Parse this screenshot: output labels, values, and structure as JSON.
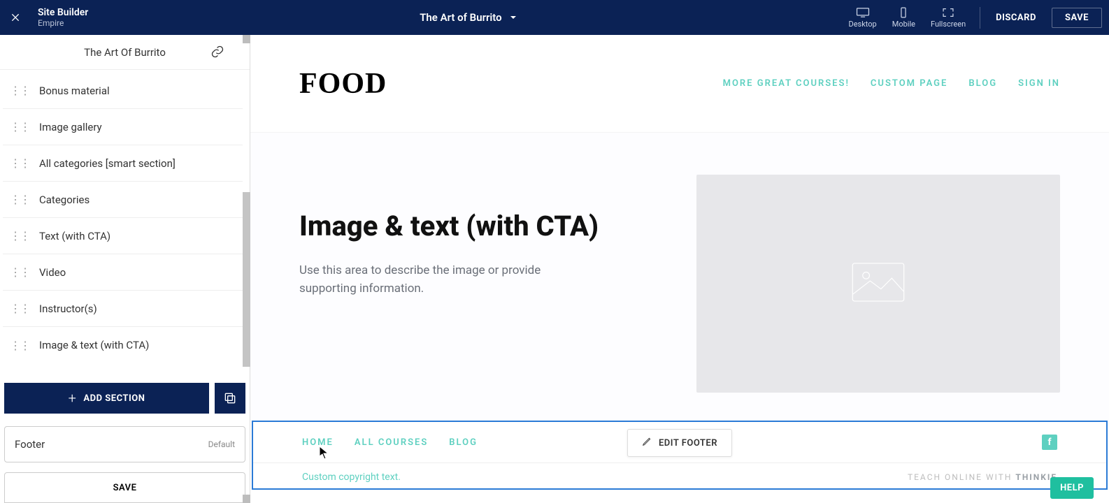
{
  "topbar": {
    "title": "Site Builder",
    "subtitle": "Empire",
    "page_name": "The Art of Burrito",
    "devices": {
      "desktop": "Desktop",
      "mobile": "Mobile",
      "fullscreen": "Fullscreen"
    },
    "discard": "DISCARD",
    "save": "SAVE"
  },
  "sidebar": {
    "header_title": "The Art Of Burrito",
    "sections": [
      {
        "label": "Bonus material"
      },
      {
        "label": "Image gallery"
      },
      {
        "label": "All categories [smart section]"
      },
      {
        "label": "Categories"
      },
      {
        "label": "Text (with CTA)"
      },
      {
        "label": "Video"
      },
      {
        "label": "Instructor(s)"
      },
      {
        "label": "Image & text (with CTA)"
      }
    ],
    "add_section": "ADD SECTION",
    "footer_label": "Footer",
    "footer_badge": "Default",
    "save": "SAVE"
  },
  "preview": {
    "logo_text": "FOOD",
    "nav": {
      "courses": "MORE GREAT COURSES!",
      "custom": "CUSTOM PAGE",
      "blog": "BLOG",
      "signin": "SIGN IN"
    },
    "hero": {
      "title": "Image & text (with CTA)",
      "body": "Use this area to describe the image or provide supporting information."
    },
    "footer": {
      "links": {
        "home": "HOME",
        "all": "ALL COURSES",
        "blog": "BLOG"
      },
      "edit": "EDIT FOOTER",
      "copyright": "Custom copyright text.",
      "teach_prefix": "TEACH ONLINE WITH ",
      "teach_brand": "THINKIF"
    },
    "help": "HELP"
  }
}
